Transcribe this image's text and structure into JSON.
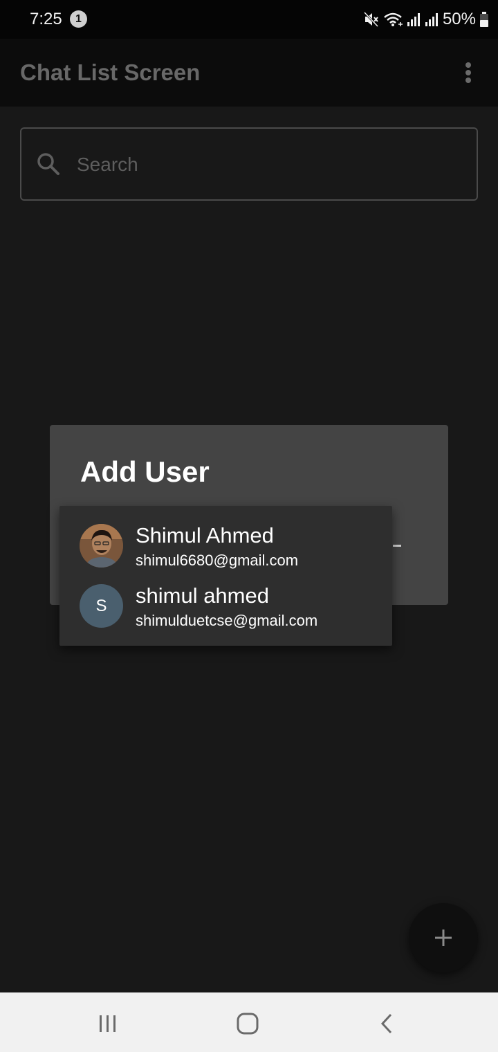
{
  "status_bar": {
    "time": "7:25",
    "notification_count": "1",
    "battery": "50%"
  },
  "app_bar": {
    "title": "Chat List Screen"
  },
  "search": {
    "placeholder": "Search",
    "value": ""
  },
  "dialog": {
    "title": "Add User"
  },
  "dropdown": {
    "items": [
      {
        "name": "Shimul Ahmed",
        "email": "shimul6680@gmail.com",
        "avatar_type": "photo"
      },
      {
        "name": "shimul ahmed",
        "email": "shimulduetcse@gmail.com",
        "avatar_type": "letter",
        "avatar_letter": "S"
      }
    ]
  },
  "fab": {
    "icon": "plus-icon"
  },
  "colors": {
    "background": "#181818",
    "app_bar": "#0c0c0c",
    "dialog": "#444444",
    "dropdown": "#2e2e2e",
    "avatar_letter_bg": "#4a5f6e",
    "nav_bar": "#f1f1f1"
  }
}
